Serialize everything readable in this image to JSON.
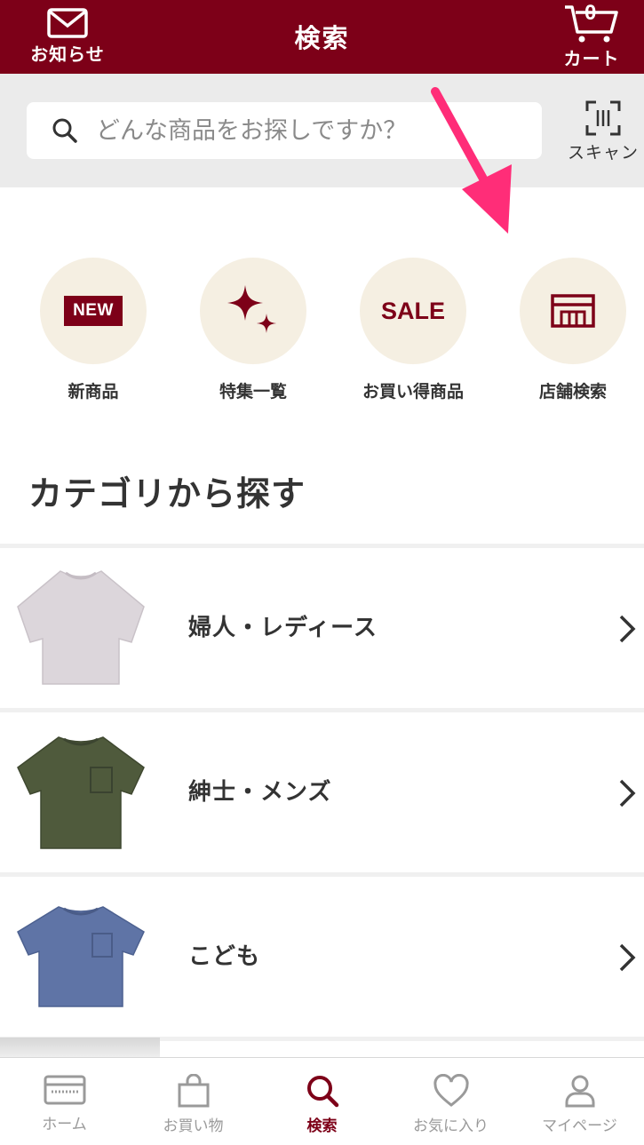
{
  "header": {
    "notifications_label": "お知らせ",
    "title": "検索",
    "cart_label": "カート",
    "cart_count": "0"
  },
  "search": {
    "placeholder": "どんな商品をお探しですか？",
    "scan_label": "スキャン"
  },
  "quick_links": [
    {
      "label": "新商品",
      "badge": "NEW",
      "icon": "new-badge-icon"
    },
    {
      "label": "特集一覧",
      "icon": "sparkle-icon"
    },
    {
      "label": "お買い得商品",
      "badge": "SALE",
      "icon": "sale-icon"
    },
    {
      "label": "店舗検索",
      "icon": "store-icon"
    }
  ],
  "categories_title": "カテゴリから探す",
  "categories": [
    {
      "label": "婦人・レディース",
      "image": "lilac-tshirt",
      "color": "#dcd6db"
    },
    {
      "label": "紳士・メンズ",
      "image": "olive-pocket-tshirt",
      "color": "#4f5a3c"
    },
    {
      "label": "こども",
      "image": "blue-pocket-tshirt",
      "color": "#5f74a6"
    }
  ],
  "bottom_nav": [
    {
      "label": "ホーム",
      "icon": "home-card-icon",
      "active": false
    },
    {
      "label": "お買い物",
      "icon": "shopping-bag-icon",
      "active": false
    },
    {
      "label": "検索",
      "icon": "search-icon",
      "active": true
    },
    {
      "label": "お気に入り",
      "icon": "heart-icon",
      "active": false
    },
    {
      "label": "マイページ",
      "icon": "person-icon",
      "active": false
    }
  ],
  "colors": {
    "brand": "#7d0018",
    "accent_arrow": "#ff2d78",
    "circle_bg": "#f5efe2"
  }
}
